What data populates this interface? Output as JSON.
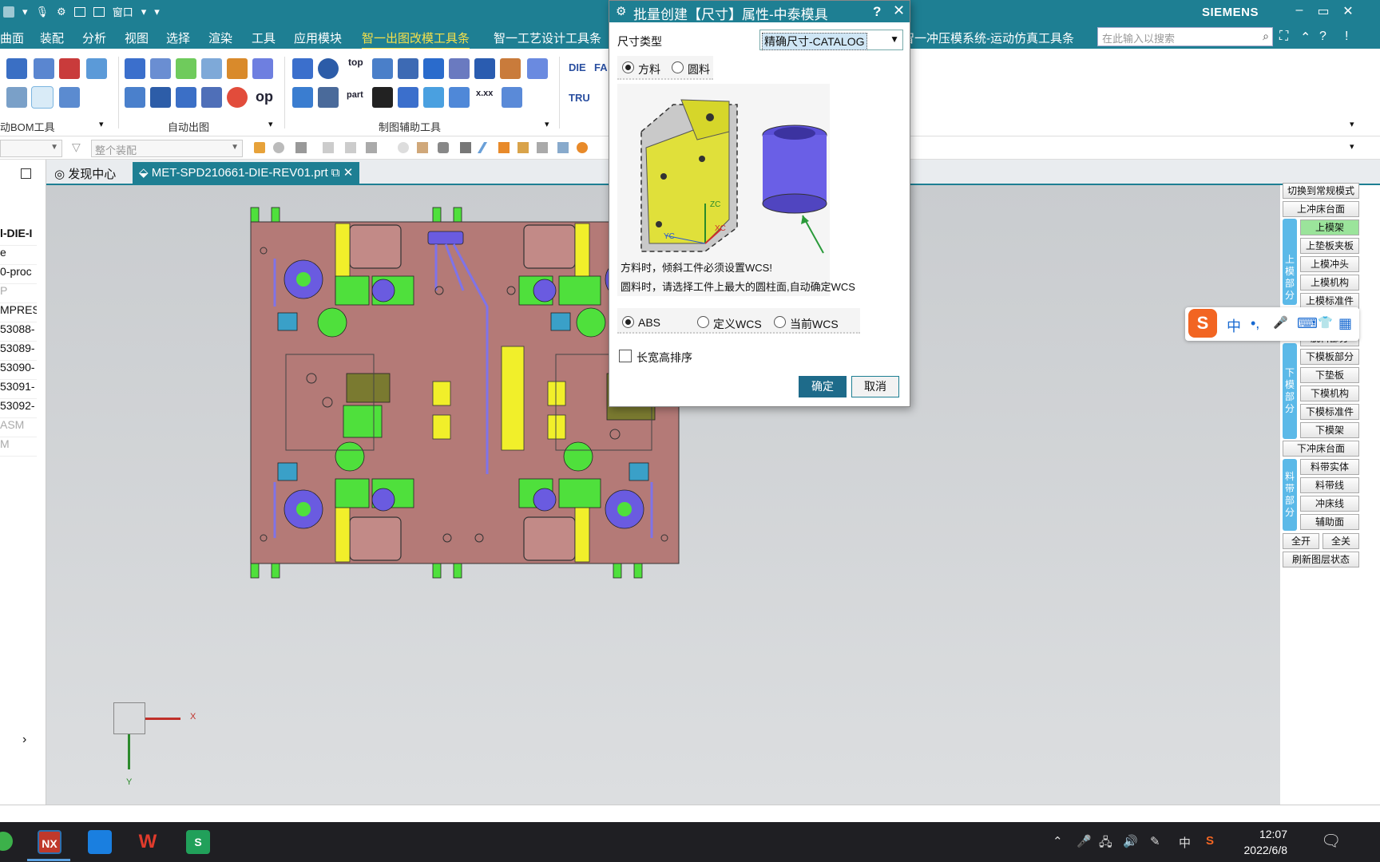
{
  "titlebar": {
    "brand": "SIEMENS",
    "window_menu": "窗口",
    "minimize": "–",
    "restore": "▭",
    "close": "✕"
  },
  "menubar": {
    "items": [
      "曲面",
      "装配",
      "分析",
      "视图",
      "选择",
      "渲染",
      "工具",
      "应用模块",
      "智一出图改模工具条",
      "智一工艺设计工具条",
      "智一冲压模系统-运动仿真工具条"
    ],
    "active_index": 8,
    "search_placeholder": "在此输入以搜索"
  },
  "ribbon": {
    "groups": [
      "动BOM工具",
      "自动出图",
      "制图辅助工具"
    ],
    "text_buttons": [
      "top",
      "op",
      "DIE",
      "FA",
      "TRU",
      "part",
      "x.xx"
    ]
  },
  "selbar": {
    "filter_placeholder": "整个装配"
  },
  "leftpanel": {
    "rows": [
      "l-DIE-I",
      "e",
      "0-proc",
      "P",
      "MPRESS",
      "53088-",
      "53089-",
      "53090-",
      "53091-",
      "53092-",
      "ASM",
      "M"
    ],
    "scroll_arrow": "›"
  },
  "tabs": [
    {
      "label": "发现中心"
    },
    {
      "label": "MET-SPD210661-DIE-REV01.prt"
    }
  ],
  "viewport": {
    "axis_x": "X",
    "axis_y": "Y",
    "model_labels": [
      "ZC",
      "XC",
      "YC"
    ]
  },
  "rightpanel": {
    "buttons": [
      "切换到常规模式",
      "上冲床台面",
      "上模架",
      "上垫板夹板",
      "上模冲头",
      "上模机构",
      "上模标准件",
      "脱料部分",
      "下模板部分",
      "下垫板",
      "下模机构",
      "下模标准件",
      "下模架",
      "下冲床台面",
      "料带实体",
      "料带线",
      "冲床线",
      "辅助面",
      "全开",
      "全关",
      "刷新图层状态"
    ],
    "sections": [
      "上模部分",
      "下模部分",
      "料带部分"
    ]
  },
  "ime": {
    "icons": [
      "S",
      "中",
      "•,",
      "🎤",
      "⌨",
      "👕",
      "▦"
    ]
  },
  "dialog": {
    "title": "批量创建【尺寸】属性-中泰模具",
    "help": "?",
    "close": "✕",
    "size_type_label": "尺寸类型",
    "size_type_value": "精确尺寸-CATALOG",
    "material_options": [
      {
        "label": "方料",
        "selected": true
      },
      {
        "label": "圆料",
        "selected": false
      }
    ],
    "note_square": "方料时，倾斜工件必须设置WCS!",
    "note_round": "圆料时，请选择工件上最大的圆柱面,自动确定WCS",
    "coord_options": [
      {
        "label": "ABS",
        "selected": true
      },
      {
        "label": "定义WCS",
        "selected": false
      },
      {
        "label": "当前WCS",
        "selected": false
      }
    ],
    "sort_checkbox_label": "长宽高排序",
    "sort_checked": false,
    "ok_label": "确定",
    "cancel_label": "取消",
    "image_labels": [
      "ZC",
      "XC",
      "YC"
    ]
  },
  "taskbar": {
    "apps": [
      "NX",
      "",
      "W",
      "S"
    ],
    "time": "12:07",
    "date": "2022/6/8",
    "tray_lang": "中"
  },
  "colors": {
    "teal": "#1e7f93",
    "accent_menu": "#f5e04a",
    "plate": "#b47a77",
    "yellow": "#f1ef2a",
    "green": "#4fe03c",
    "blue_part": "#6a5be0"
  }
}
